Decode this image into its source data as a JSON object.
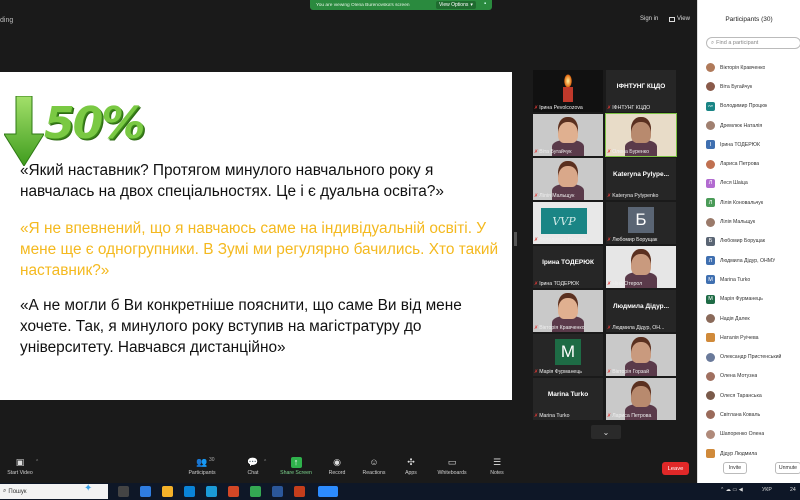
{
  "app_title": "ding",
  "top": {
    "viewing_banner": "You are viewing Olena Burenovska's screen",
    "view_options": "View Options",
    "sign_in": "Sign in",
    "view": "View"
  },
  "slide": {
    "percent": "50%",
    "q1": "«Який наставник? Протягом минулого навчального року я навчалась на двох спеціальностях. Це і є дуальна освіта?»",
    "q2": "«Я не впевнений, що я навчаюсь саме на індивідуальній освіті. У мене ще є одногрупники. В Зумі ми регулярно бачились. Хто такий наставник?»",
    "q3": "«А не могли б Ви конкретніше пояснити, що саме Ви від мене хочете. Так, я минулого року вступив на магістратуру до університету. Навчався дистанційно»",
    "colors": {
      "accent_green": "#7ac943",
      "quote_yellow": "#f4b91f"
    }
  },
  "tiles": [
    {
      "name": "Ірина Реvolcozova",
      "kind": "candle"
    },
    {
      "name": "ІФНТУНГ КЦДО",
      "big": "ІФНТУНГ КЦДО",
      "kind": "text"
    },
    {
      "name": "Віта Бугайчук",
      "kind": "photo"
    },
    {
      "name": "Олена Буренко",
      "kind": "photo",
      "active": true
    },
    {
      "name": "Лілія Мальщук",
      "kind": "photo"
    },
    {
      "name": "Kateryna Pylypenko",
      "big": "Kateryna Pylype...",
      "kind": "text"
    },
    {
      "name": "Володимир Процюк",
      "kind": "vvp",
      "logo": "VVP"
    },
    {
      "name": "Любомир Борущак",
      "kind": "letter",
      "letter": "Б",
      "color": "#5a6574"
    },
    {
      "name": "Ірина ТОДЕРЮК",
      "big": "Ірина ТОДЕРЮК",
      "kind": "text"
    },
    {
      "name": "Ніна Отерол",
      "kind": "photo"
    },
    {
      "name": "Вікторія Кравченко",
      "kind": "photo"
    },
    {
      "name": "Людмила Дідур, ОН...",
      "big": "Людмила Дідур...",
      "kind": "text"
    },
    {
      "name": "Марія Фурманець",
      "kind": "letter",
      "letter": "М",
      "color": "#1e6b45"
    },
    {
      "name": "Вікторія Горзай",
      "kind": "photo"
    },
    {
      "name": "Marina Turko",
      "big": "Marina Turko",
      "kind": "text"
    },
    {
      "name": "Лариса Петрова",
      "kind": "photo"
    }
  ],
  "toolbar": {
    "start_video": "Start Video",
    "participants": "Participants",
    "participants_count": "30",
    "chat": "Chat",
    "share_screen": "Share Screen",
    "record": "Record",
    "reactions": "Reactions",
    "apps": "Apps",
    "whiteboards": "Whiteboards",
    "notes": "Notes",
    "leave": "Leave"
  },
  "panel": {
    "title": "Participants (30)",
    "search_placeholder": "Find a participant",
    "invite": "Invite",
    "unmute": "Unmute",
    "participants": [
      {
        "name": "Вікторія Кравченко",
        "initial": "",
        "color": "#b07a5a",
        "photo": true
      },
      {
        "name": "Віта Бугайчук",
        "initial": "",
        "color": "#8a5a4a",
        "photo": true
      },
      {
        "name": "Володимир Процюк",
        "initial": "VVP",
        "color": "#1a8585",
        "photo": false
      },
      {
        "name": "Дремлюк Наталія",
        "initial": "",
        "color": "#a08070",
        "photo": true
      },
      {
        "name": "Ірина ТОДЕРЮК",
        "initial": "І",
        "color": "#3f6fb0",
        "photo": false
      },
      {
        "name": "Лариса Петрова",
        "initial": "",
        "color": "#c07050",
        "photo": true
      },
      {
        "name": "Леся Шаіца",
        "initial": "Л",
        "color": "#b26bd0",
        "photo": false
      },
      {
        "name": "Лілія Коновальчук",
        "initial": "Л",
        "color": "#4a9b58",
        "photo": false
      },
      {
        "name": "Лілія Мальщук",
        "initial": "",
        "color": "#9a7a6a",
        "photo": true
      },
      {
        "name": "Любомир Борущак",
        "initial": "Б",
        "color": "#5a6574",
        "photo": false
      },
      {
        "name": "Людмила Дідур, ОНМУ",
        "initial": "Л",
        "color": "#3f6fb0",
        "photo": false
      },
      {
        "name": "Marina Turko",
        "initial": "M",
        "color": "#3f6fb0",
        "photo": false
      },
      {
        "name": "Марія Фурманець",
        "initial": "М",
        "color": "#1e6b45",
        "photo": false
      },
      {
        "name": "Надія Далек",
        "initial": "",
        "color": "#8a6a5a",
        "photo": true
      },
      {
        "name": "Наталія Руічева",
        "initial": "",
        "color": "#d08a3a",
        "photo": false
      },
      {
        "name": "Олександр Пристенський",
        "initial": "",
        "color": "#6a7a9a",
        "photo": true
      },
      {
        "name": "Олена Мотузна",
        "initial": "",
        "color": "#a07060",
        "photo": true
      },
      {
        "name": "Олеся Таранська",
        "initial": "",
        "color": "#7a5a4a",
        "photo": true
      },
      {
        "name": "Світлана Коваль",
        "initial": "",
        "color": "#9a6a5a",
        "photo": true
      },
      {
        "name": "Шапоренко Олена",
        "initial": "",
        "color": "#b08a7a",
        "photo": true
      },
      {
        "name": "Дідур Людмила",
        "initial": "",
        "color": "#d08a3a",
        "photo": false
      }
    ]
  },
  "taskbar": {
    "search_text": "Пошук",
    "lang": "УКР",
    "time": "24"
  }
}
